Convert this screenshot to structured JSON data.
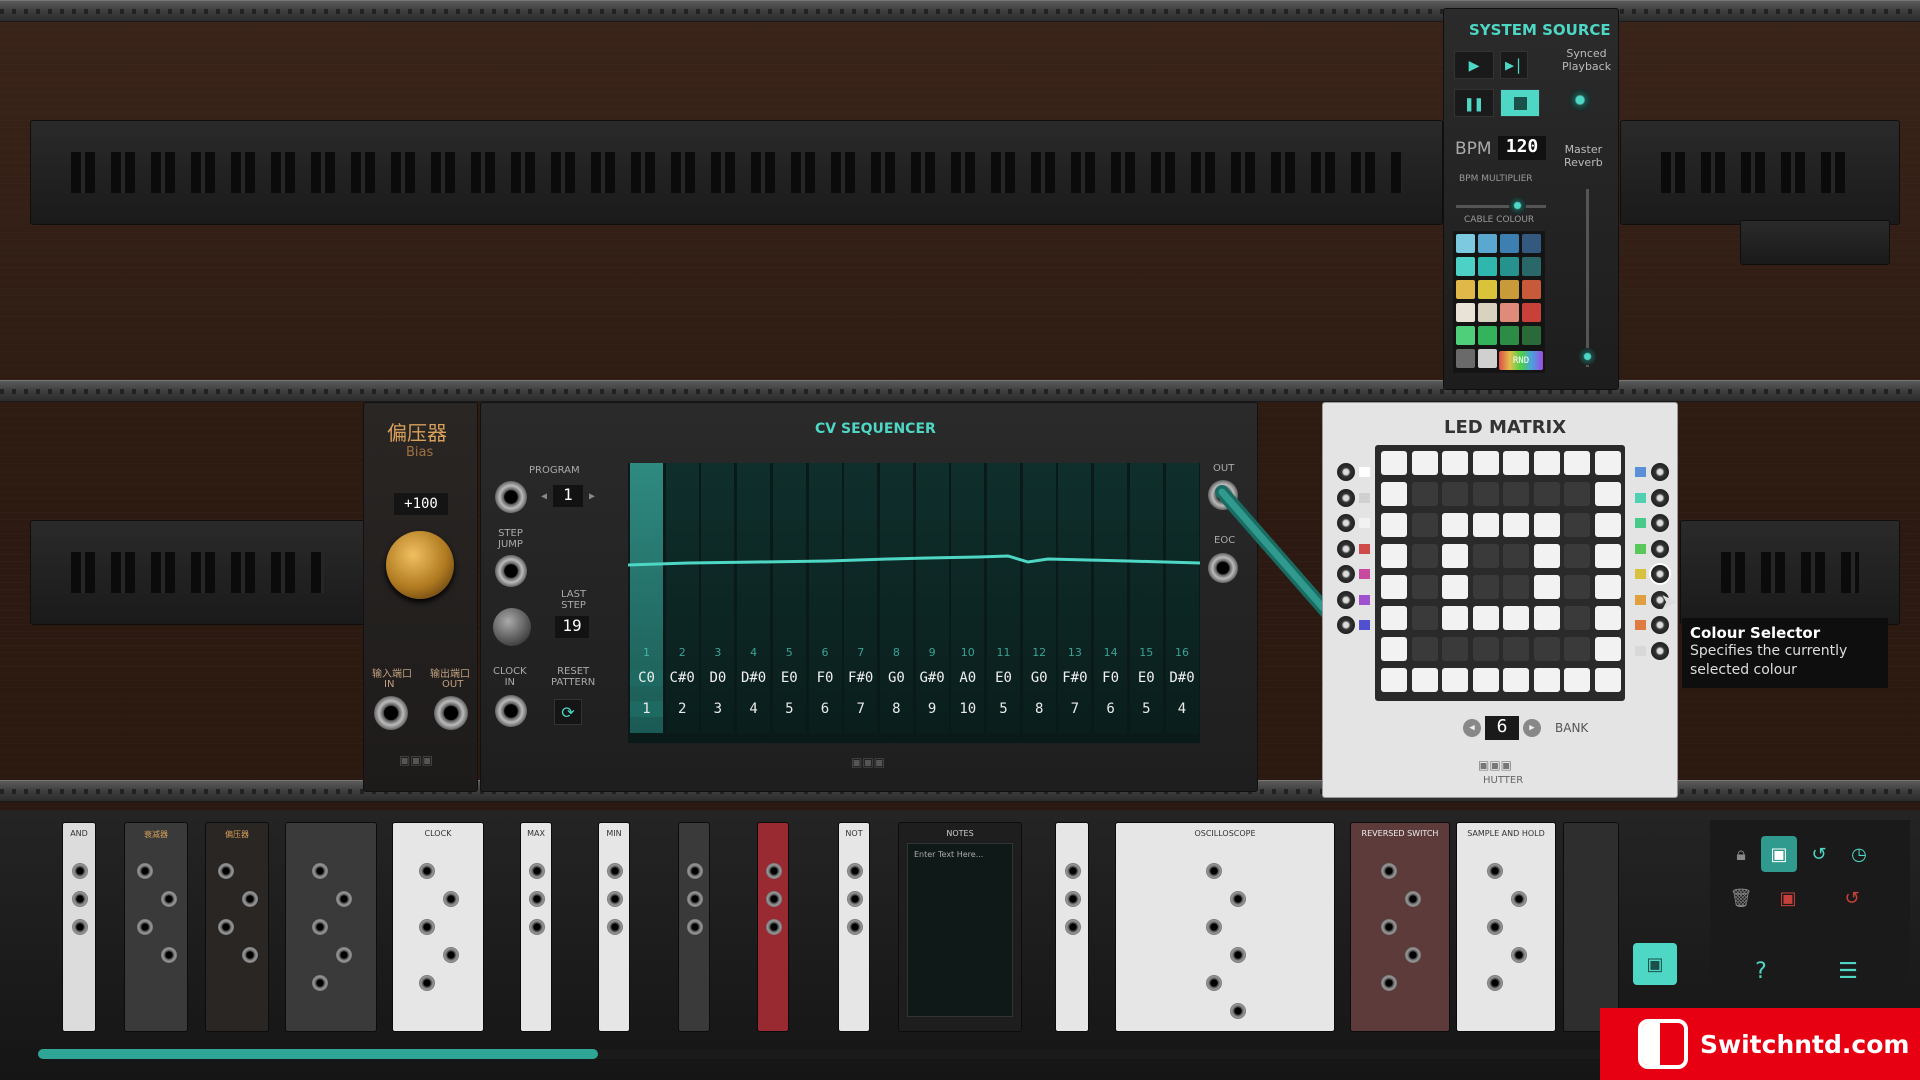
{
  "system_source": {
    "title": "SYSTEM SOURCE",
    "synced_playback": "Synced\nPlayback",
    "bpm_label": "BPM",
    "bpm_value": "120",
    "bpm_multiplier_label": "BPM MULTIPLIER",
    "master_reverb": "Master\nReverb",
    "cable_colour_label": "CABLE COLOUR",
    "rnd_label": "RND",
    "swatches": [
      "#7cc9e0",
      "#5aa8d0",
      "#3d7fb0",
      "#34597e",
      "#4dd0c6",
      "#2fb7ae",
      "#27928d",
      "#2a6768",
      "#e0b84a",
      "#d8c33a",
      "#c89a3a",
      "#c65a3a",
      "#e8e3d6",
      "#d9d2bf",
      "#e08a7a",
      "#c8403a",
      "#4fcf7a",
      "#32b35c",
      "#2c8c45",
      "#2a6a38",
      "#6a6a6a",
      "#d0d0d0"
    ]
  },
  "bias": {
    "title": "偏压器",
    "subtitle": "Bias",
    "value": "+100",
    "in_label_cn": "输入端口",
    "in_label": "IN",
    "out_label_cn": "输出端口",
    "out_label": "OUT"
  },
  "sequencer": {
    "title": "CV SEQUENCER",
    "program_label": "PROGRAM",
    "program_value": "1",
    "step_jump_label": "STEP\nJUMP",
    "last_step_label": "LAST\nSTEP",
    "last_step_value": "19",
    "clock_in_label": "CLOCK\nIN",
    "reset_pattern_label": "RESET\nPATTERN",
    "out_label": "OUT",
    "eoc_label": "EOC",
    "step_indices": [
      "1",
      "2",
      "3",
      "4",
      "5",
      "6",
      "7",
      "8",
      "9",
      "10",
      "11",
      "12",
      "13",
      "14",
      "15",
      "16"
    ],
    "notes": [
      "C0",
      "C#0",
      "D0",
      "D#0",
      "E0",
      "F0",
      "F#0",
      "G0",
      "G#0",
      "A0",
      "E0",
      "G0",
      "F#0",
      "F0",
      "E0",
      "D#0"
    ],
    "step_numbers": [
      "1",
      "2",
      "3",
      "4",
      "5",
      "6",
      "7",
      "8",
      "9",
      "10",
      "5",
      "8",
      "7",
      "6",
      "5",
      "4"
    ],
    "progress": 0.26
  },
  "led_matrix": {
    "title": "LED MATRIX",
    "bank_value": "6",
    "bank_label": "BANK",
    "brand": "HUTTER",
    "right_colors": [
      "#5b8fd8",
      "#4fd0b0",
      "#48c98a",
      "#5ac75a",
      "#d8c040",
      "#e0a040",
      "#e07a40",
      "#d8d8d8"
    ],
    "left_colors": [
      "#ffffff",
      "#d0d0d0",
      "#f2f2f2",
      "#d04a4a",
      "#c84aa0",
      "#a050d0",
      "#5050d0"
    ]
  },
  "tooltip": {
    "title": "Colour Selector",
    "body": "Specifies the currently\nselected colour"
  },
  "tray_modules": [
    {
      "label": "AND"
    },
    {
      "label": "衰减器"
    },
    {
      "label": "偏压器"
    },
    {
      "label": ""
    },
    {
      "label": "CLOCK"
    },
    {
      "label": "MAX"
    },
    {
      "label": "MIN"
    },
    {
      "label": ""
    },
    {
      "label": ""
    },
    {
      "label": "NOT"
    },
    {
      "label": "NOTES",
      "placeholder": "Enter Text Here..."
    },
    {
      "label": ""
    },
    {
      "label": "OSCILLOSCOPE"
    },
    {
      "label": "REVERSED SWITCH"
    },
    {
      "label": "SAMPLE AND HOLD"
    }
  ],
  "watermark": "Switchntd.com"
}
